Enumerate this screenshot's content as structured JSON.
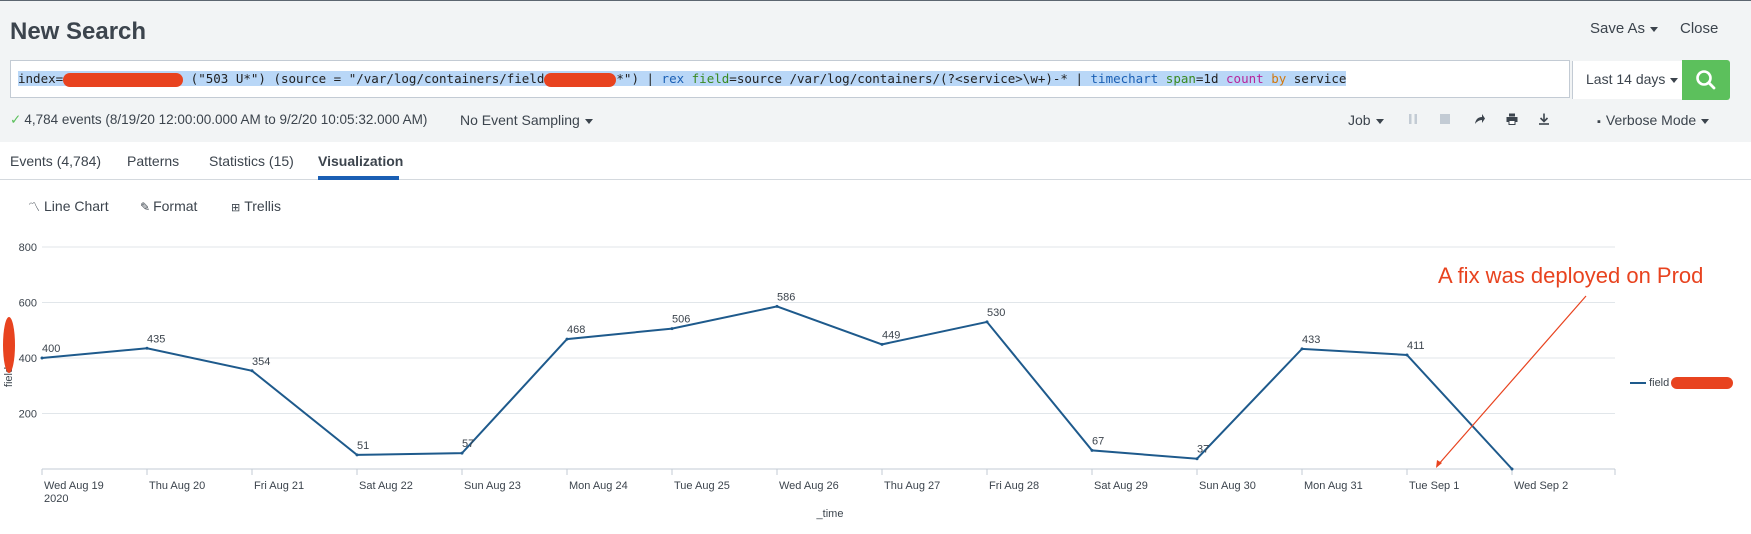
{
  "header": {
    "title": "New Search",
    "save_as": "Save As",
    "close": "Close"
  },
  "search": {
    "query_parts": {
      "index": "index=",
      "s1": " (\"503 U*\") (source = \"/var/log/containers/field",
      "s2": "*\") | ",
      "rex": "rex",
      "sp": " ",
      "field_kw": "field",
      "s3": "=source /var/log/containers/(?<service>\\w+)-* | ",
      "timechart": "timechart",
      "span_kw": "span",
      "s4": "=1d ",
      "count": "count",
      "by": "by",
      "s5": " service"
    },
    "time_range": "Last 14 days",
    "go_icon": "search-icon"
  },
  "status": {
    "events": "4,784 events (8/19/20 12:00:00.000 AM to 9/2/20 10:05:32.000 AM)",
    "sampling": "No Event Sampling",
    "job": "Job",
    "mode": "Verbose Mode"
  },
  "tabs": {
    "events": "Events (4,784)",
    "patterns": "Patterns",
    "statistics": "Statistics (15)",
    "visualization": "Visualization"
  },
  "vizbar": {
    "line_chart": "Line Chart",
    "format": "Format",
    "trellis": "Trellis"
  },
  "annotation": "A fix was deployed on Prod",
  "colors": {
    "line": "#1e5a8c",
    "annotation": "#e8431f",
    "go": "#5cc05c",
    "accent": "#1a5fb4"
  },
  "chart_data": {
    "type": "line",
    "x": [
      "Wed Aug 19",
      "Thu Aug 20",
      "Fri Aug 21",
      "Sat Aug 22",
      "Sun Aug 23",
      "Mon Aug 24",
      "Tue Aug 25",
      "Wed Aug 26",
      "Thu Aug 27",
      "Fri Aug 28",
      "Sat Aug 29",
      "Sun Aug 30",
      "Mon Aug 31",
      "Tue Sep 1",
      "Wed Sep 2"
    ],
    "first_tick_year": "2020",
    "series": [
      {
        "name": "field",
        "values": [
          400,
          435,
          354,
          51,
          57,
          468,
          506,
          586,
          449,
          530,
          67,
          37,
          433,
          411,
          0
        ]
      }
    ],
    "data_labels": [
      "400",
      "435",
      "354",
      "51",
      "57",
      "468",
      "506",
      "586",
      "449",
      "530",
      "67",
      "37",
      "433",
      "411",
      ""
    ],
    "xlabel": "_time",
    "ylabel": "field",
    "yticks": [
      "200",
      "400",
      "600",
      "800"
    ],
    "ylim": [
      0,
      800
    ],
    "grid": true,
    "legend_position": "right"
  }
}
